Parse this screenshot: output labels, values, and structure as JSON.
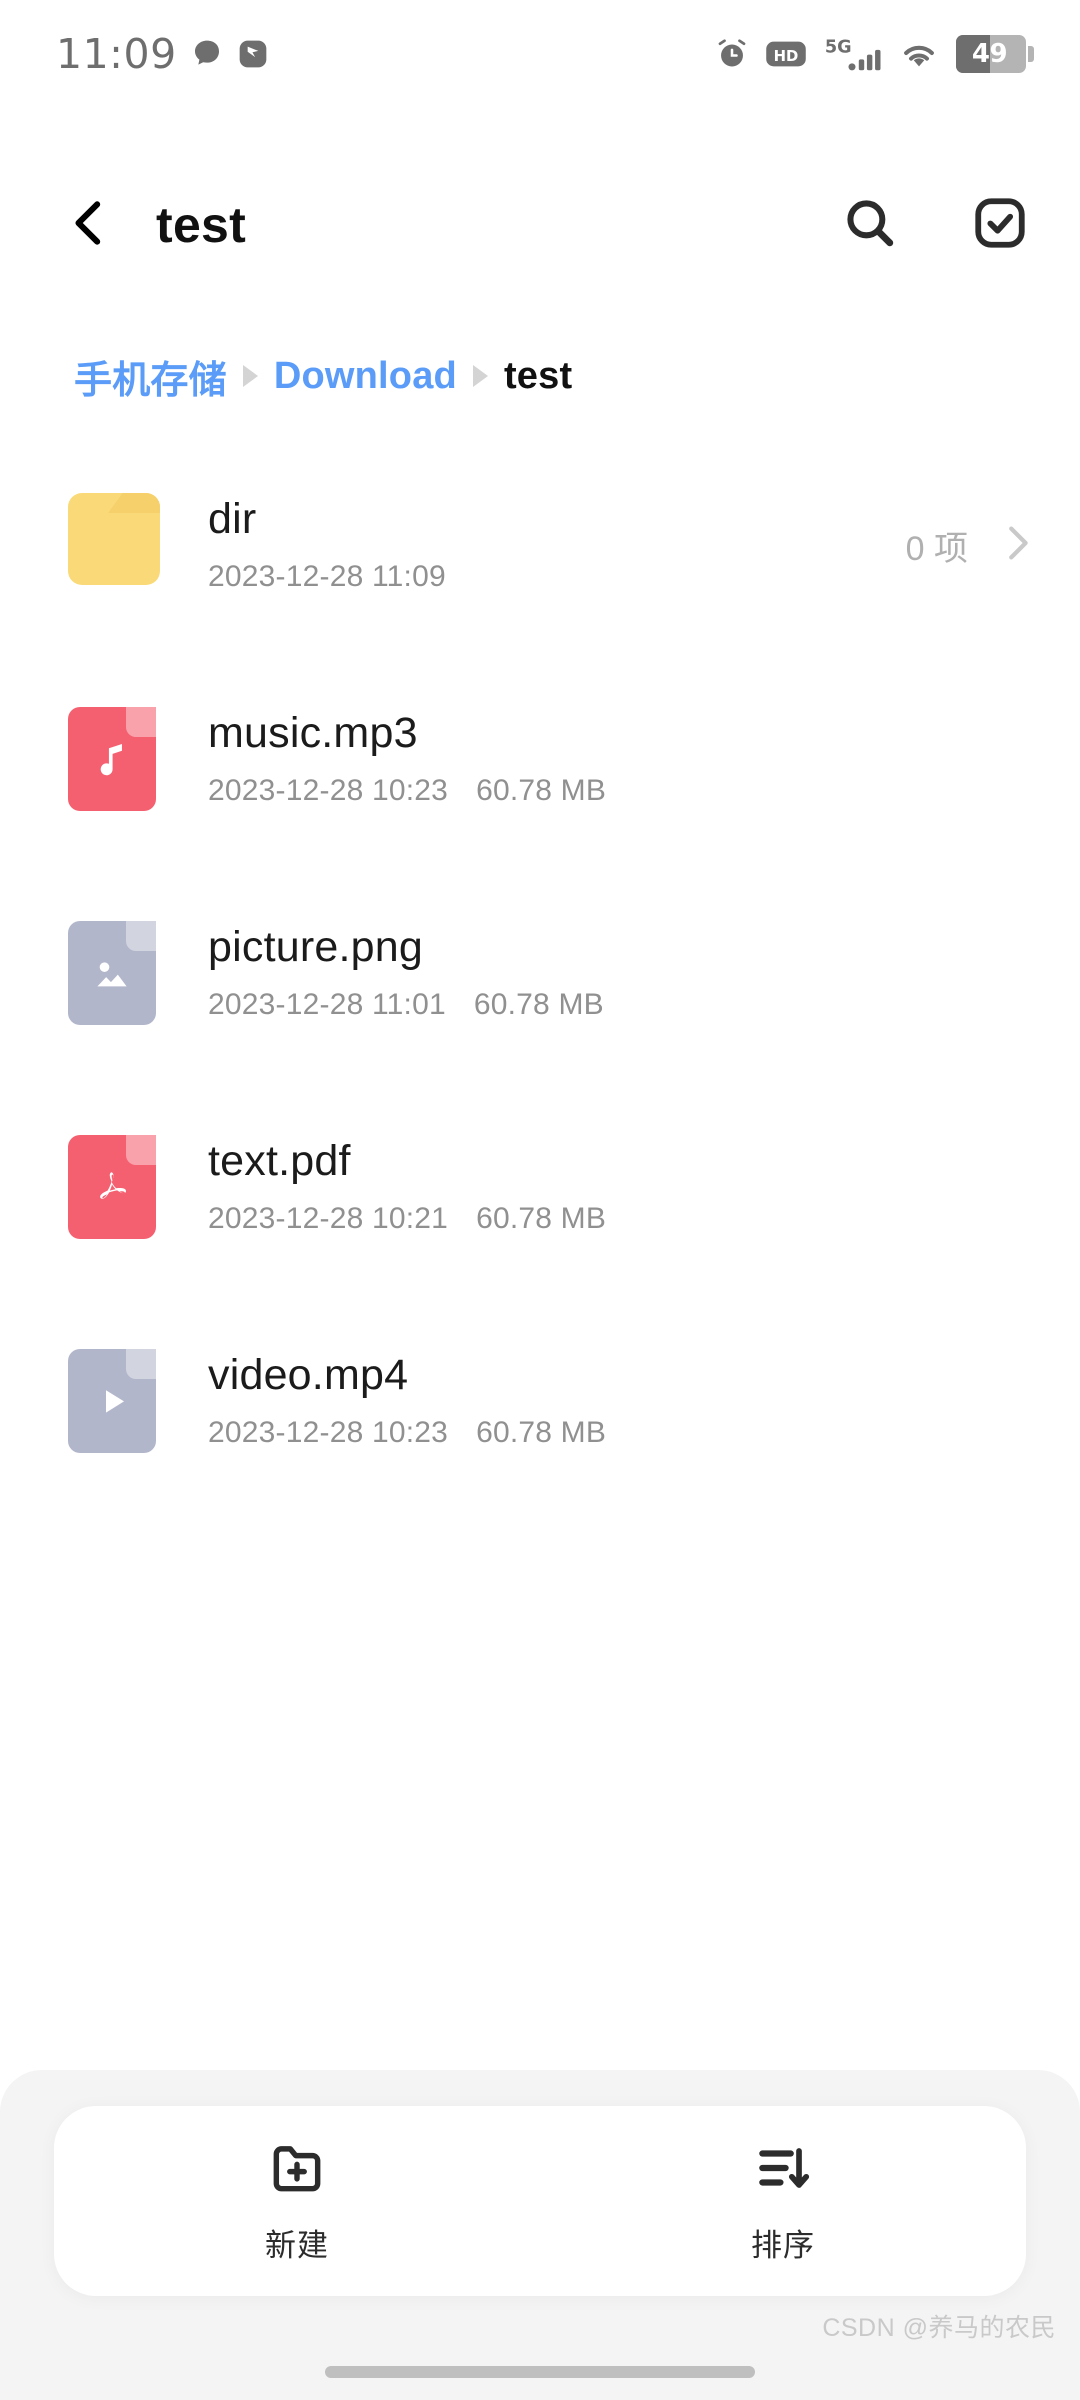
{
  "status_bar": {
    "time": "11:09",
    "left_icons": [
      "chat-bubble-icon",
      "app-badge-icon"
    ],
    "right_icons": [
      "alarm-icon",
      "hd-icon",
      "5g-signal-icon",
      "wifi-icon"
    ],
    "network_label": "5G",
    "hd_label": "HD",
    "battery_percent": "49"
  },
  "app_bar": {
    "back_icon": "chevron-left-icon",
    "title": "test",
    "search_icon": "search-icon",
    "select_icon": "check-square-icon"
  },
  "breadcrumb": {
    "items": [
      {
        "label": "手机存储",
        "current": false
      },
      {
        "label": "Download",
        "current": false
      },
      {
        "label": "test",
        "current": true
      }
    ],
    "separator_icon": "triangle-right-icon"
  },
  "files": [
    {
      "name": "dir",
      "date": "2023-12-28 11:09",
      "size": "",
      "item_count": "0 项",
      "icon": "folder-icon",
      "is_folder": true
    },
    {
      "name": "music.mp3",
      "date": "2023-12-28 10:23",
      "size": "60.78 MB",
      "item_count": "",
      "icon": "music-file-icon",
      "is_folder": false
    },
    {
      "name": "picture.png",
      "date": "2023-12-28 11:01",
      "size": "60.78 MB",
      "item_count": "",
      "icon": "image-file-icon",
      "is_folder": false
    },
    {
      "name": "text.pdf",
      "date": "2023-12-28 10:21",
      "size": "60.78 MB",
      "item_count": "",
      "icon": "pdf-file-icon",
      "is_folder": false
    },
    {
      "name": "video.mp4",
      "date": "2023-12-28 10:23",
      "size": "60.78 MB",
      "item_count": "",
      "icon": "video-file-icon",
      "is_folder": false
    }
  ],
  "bottom_bar": {
    "new_label": "新建",
    "new_icon": "folder-plus-icon",
    "sort_label": "排序",
    "sort_icon": "sort-descending-icon"
  },
  "watermark": "CSDN @养马的农民",
  "colors": {
    "accent_blue": "#5a9cf8",
    "folder_yellow": "#fada78",
    "file_red": "#f56070",
    "file_gray": "#b2b6ca",
    "text_primary": "#1b1b1b",
    "text_secondary": "#909090"
  }
}
